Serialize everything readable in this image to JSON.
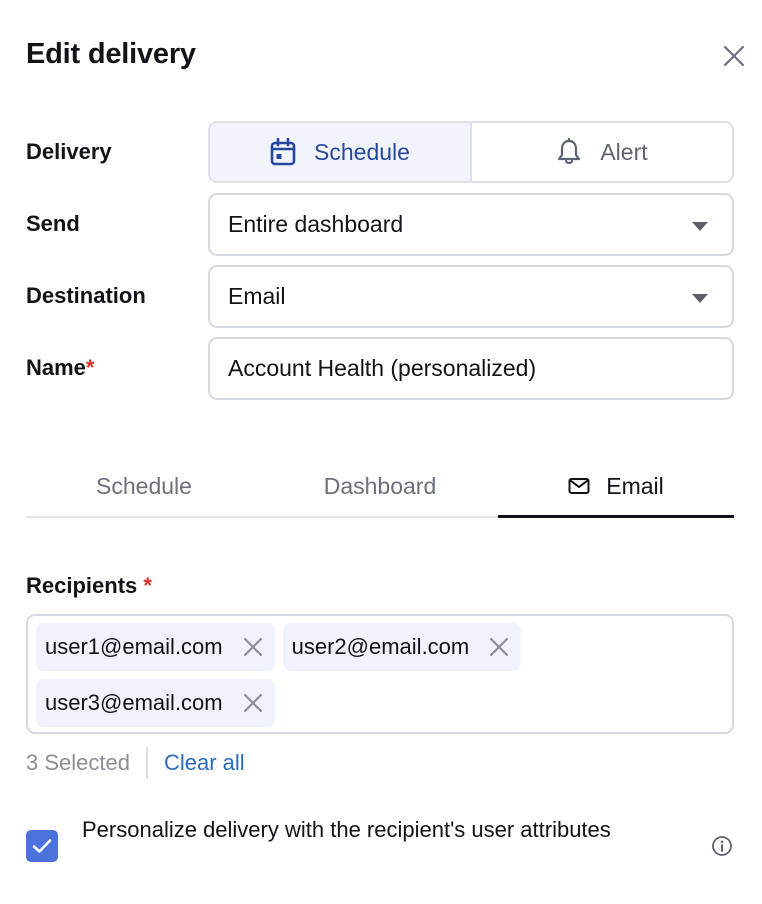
{
  "header": {
    "title": "Edit delivery",
    "close_icon": "close-icon"
  },
  "form": {
    "delivery": {
      "label": "Delivery",
      "options": [
        {
          "label": "Schedule",
          "icon": "calendar-icon",
          "selected": true
        },
        {
          "label": "Alert",
          "icon": "bell-icon",
          "selected": false
        }
      ]
    },
    "send": {
      "label": "Send",
      "value": "Entire dashboard"
    },
    "destination": {
      "label": "Destination",
      "value": "Email"
    },
    "name": {
      "label": "Name",
      "required_mark": "*",
      "value": "Account Health (personalized)"
    }
  },
  "tabs": [
    {
      "label": "Schedule",
      "active": false
    },
    {
      "label": "Dashboard",
      "active": false
    },
    {
      "label": "Email",
      "icon": "mail-icon",
      "active": true
    }
  ],
  "recipients": {
    "label": "Recipients",
    "required_mark": "*",
    "items": [
      "user1@email.com",
      "user2@email.com",
      "user3@email.com"
    ],
    "selected_count_text": "3 Selected",
    "clear_all_label": "Clear all"
  },
  "personalize": {
    "checked": true,
    "label": "Personalize delivery with the recipient's user attributes",
    "info_icon": "info-icon"
  },
  "colors": {
    "accent_blue": "#2747a0",
    "checkbox_blue": "#4b72dc",
    "link_blue": "#2a6ebb",
    "required_red": "#d93025",
    "chip_bg": "#eef3fd"
  }
}
